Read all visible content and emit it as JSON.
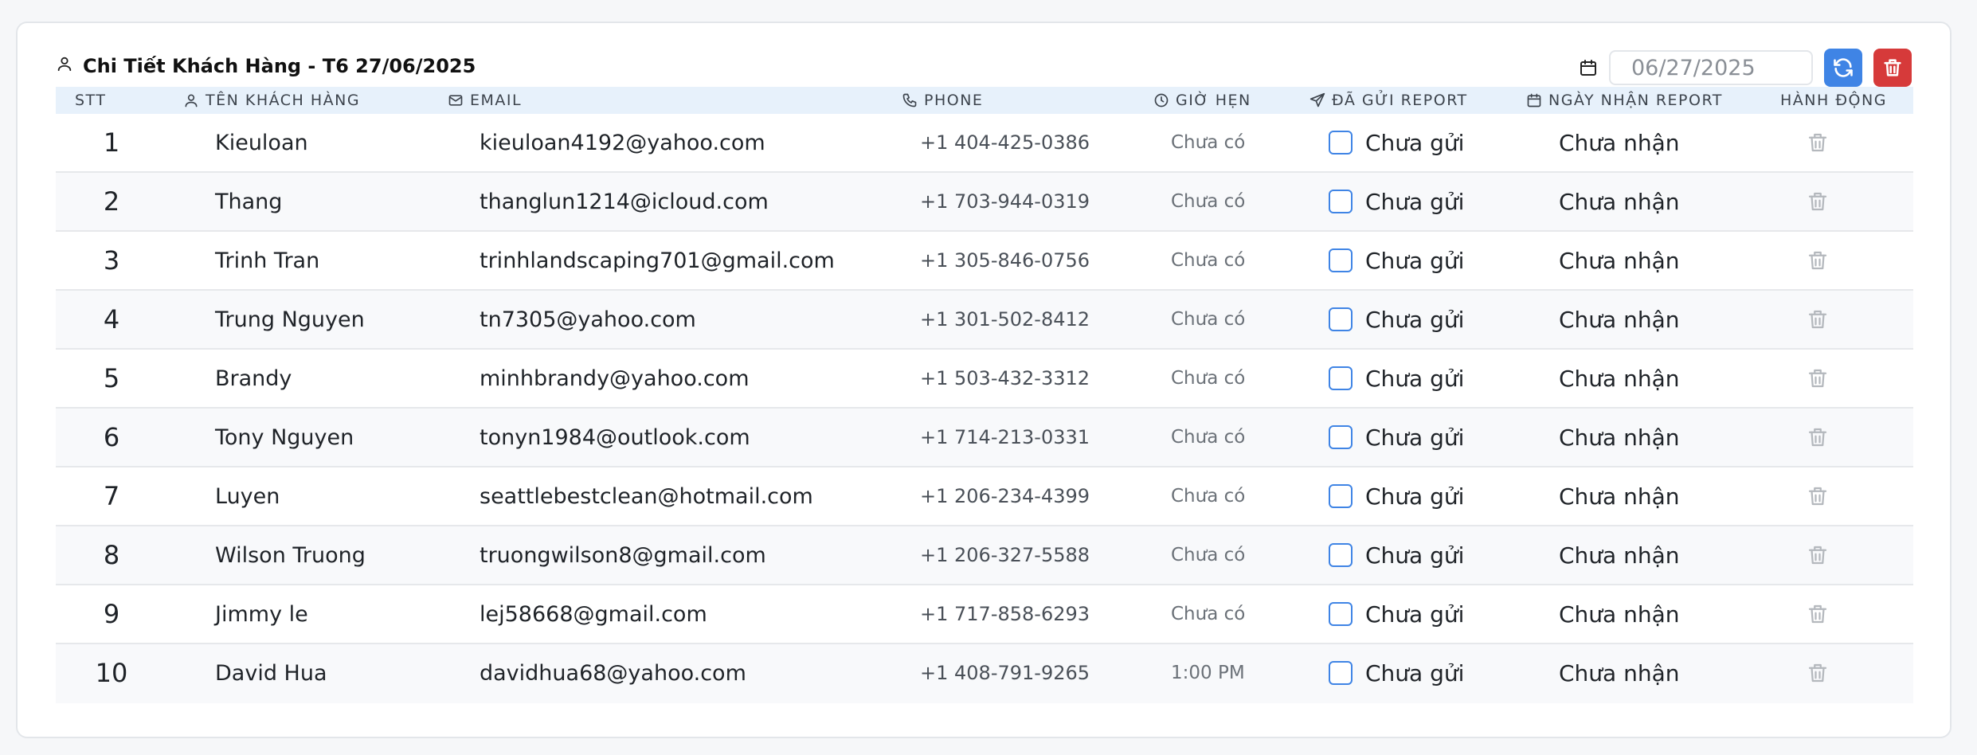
{
  "header": {
    "title": "Chi Tiết Khách Hàng - T6 27/06/2025",
    "date_value": "06/27/2025"
  },
  "columns": {
    "stt": "STT",
    "name": "TÊN KHÁCH HÀNG",
    "email": "EMAIL",
    "phone": "PHONE",
    "time": "GIỜ HẸN",
    "sent": "ĐÃ GỬI REPORT",
    "received": "NGÀY NHẬN REPORT",
    "actions": "HÀNH ĐỘNG"
  },
  "rows": [
    {
      "stt": "1",
      "name": "Kieuloan",
      "email": "kieuloan4192@yahoo.com",
      "phone": "+1 404-425-0386",
      "time": "Chưa có",
      "sent": "Chưa gửi",
      "received": "Chưa nhận"
    },
    {
      "stt": "2",
      "name": "Thang",
      "email": "thanglun1214@icloud.com",
      "phone": "+1 703-944-0319",
      "time": "Chưa có",
      "sent": "Chưa gửi",
      "received": "Chưa nhận"
    },
    {
      "stt": "3",
      "name": "Trinh Tran",
      "email": "trinhlandscaping701@gmail.com",
      "phone": "+1 305-846-0756",
      "time": "Chưa có",
      "sent": "Chưa gửi",
      "received": "Chưa nhận"
    },
    {
      "stt": "4",
      "name": "Trung Nguyen",
      "email": "tn7305@yahoo.com",
      "phone": "+1 301-502-8412",
      "time": "Chưa có",
      "sent": "Chưa gửi",
      "received": "Chưa nhận"
    },
    {
      "stt": "5",
      "name": "Brandy",
      "email": "minhbrandy@yahoo.com",
      "phone": "+1 503-432-3312",
      "time": "Chưa có",
      "sent": "Chưa gửi",
      "received": "Chưa nhận"
    },
    {
      "stt": "6",
      "name": "Tony Nguyen",
      "email": "tonyn1984@outlook.com",
      "phone": "+1 714-213-0331",
      "time": "Chưa có",
      "sent": "Chưa gửi",
      "received": "Chưa nhận"
    },
    {
      "stt": "7",
      "name": "Luyen",
      "email": "seattlebestclean@hotmail.com",
      "phone": "+1 206-234-4399",
      "time": "Chưa có",
      "sent": "Chưa gửi",
      "received": "Chưa nhận"
    },
    {
      "stt": "8",
      "name": "Wilson Truong",
      "email": "truongwilson8@gmail.com",
      "phone": "+1 206-327-5588",
      "time": "Chưa có",
      "sent": "Chưa gửi",
      "received": "Chưa nhận"
    },
    {
      "stt": "9",
      "name": "Jimmy le",
      "email": "lej58668@gmail.com",
      "phone": "+1 717-858-6293",
      "time": "Chưa có",
      "sent": "Chưa gửi",
      "received": "Chưa nhận"
    },
    {
      "stt": "10",
      "name": "David Hua",
      "email": "davidhua68@yahoo.com",
      "phone": "+1 408-791-9265",
      "time": "1:00 PM",
      "sent": "Chưa gửi",
      "received": "Chưa nhận"
    }
  ],
  "icons": {
    "title": "user-icon",
    "date": "calendar-icon",
    "refresh": "refresh-icon",
    "delete": "trash-icon",
    "name": "user-icon",
    "email": "mail-icon",
    "phone": "phone-icon",
    "time": "clock-icon",
    "sent": "send-icon",
    "received": "calendar-icon",
    "row_action": "trash-icon"
  },
  "colors": {
    "accent": "#3f84e5",
    "danger": "#d63a3a",
    "header_bg": "#e7f1fb"
  }
}
